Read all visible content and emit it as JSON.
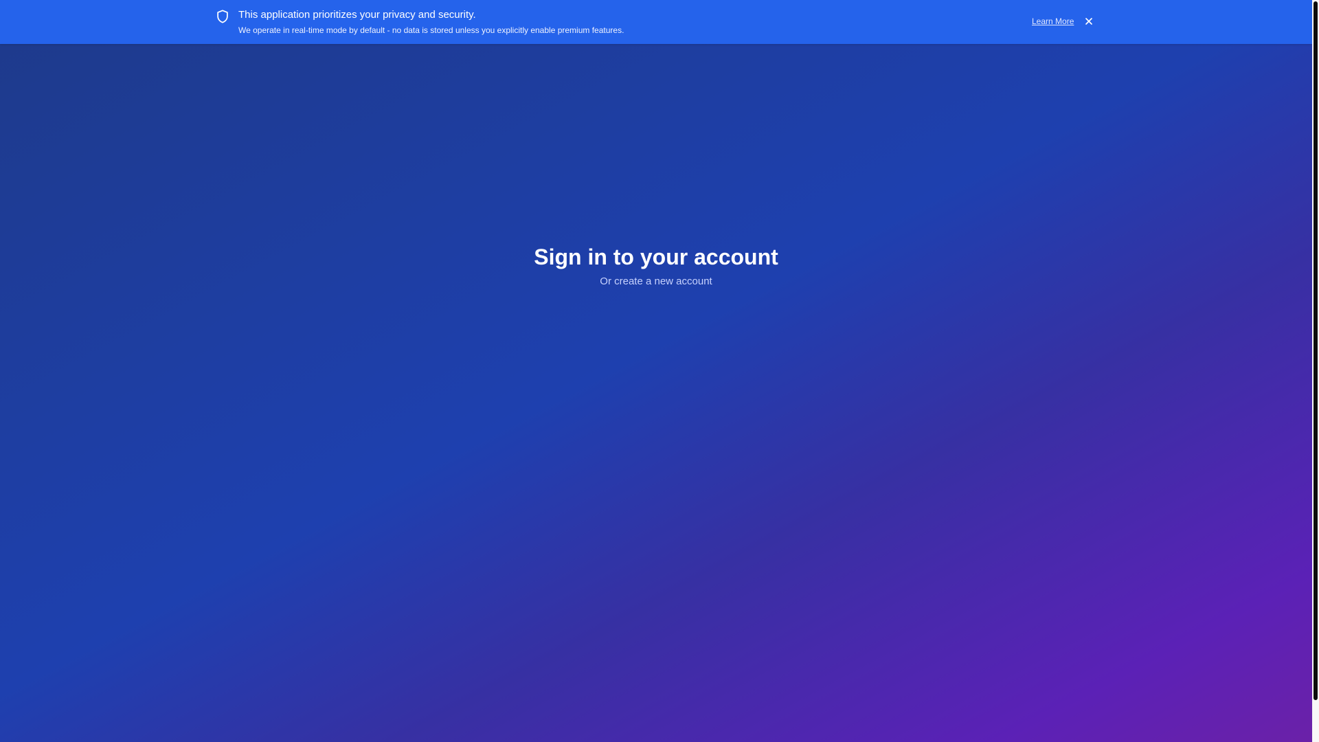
{
  "banner": {
    "icon": "shield-icon",
    "title": "This application prioritizes your privacy and security.",
    "text": "We operate in real-time mode by default - no data is stored unless you explicitly enable premium features.",
    "learn_more_label": "Learn More",
    "close_icon": "close-icon",
    "background_color": "#2563eb"
  },
  "auth": {
    "heading": "Sign in to your account",
    "subheading": "Or create a new account"
  },
  "theme": {
    "gradient_start": "#1e3a8a",
    "gradient_mid": "#1e40af",
    "gradient_end": "#6b21a8"
  }
}
